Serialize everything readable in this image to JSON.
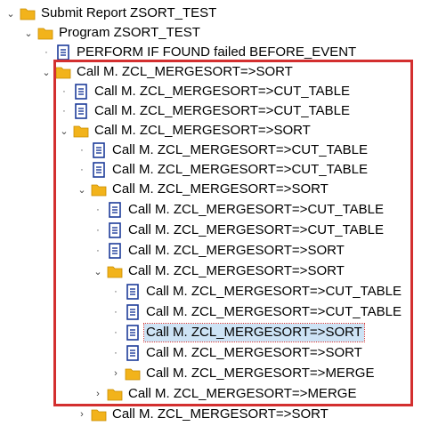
{
  "colors": {
    "folder": "#f2b31b",
    "doc": "#1d3c9a",
    "highlight_border": "#d32f2f",
    "selected_bg": "#cde3f5"
  },
  "tree": [
    {
      "label": "Submit Report ZSORT_TEST",
      "icon": "folder-icon",
      "toggle": "expanded"
    },
    {
      "label": "Program ZSORT_TEST",
      "icon": "folder-icon",
      "toggle": "expanded"
    },
    {
      "label": "PERFORM IF FOUND failed BEFORE_EVENT",
      "icon": "document-icon",
      "toggle": "leaf"
    },
    {
      "label": "Call M. ZCL_MERGESORT=>SORT",
      "icon": "folder-icon",
      "toggle": "expanded"
    },
    {
      "label": "Call M. ZCL_MERGESORT=>CUT_TABLE",
      "icon": "document-icon",
      "toggle": "leaf"
    },
    {
      "label": "Call M. ZCL_MERGESORT=>CUT_TABLE",
      "icon": "document-icon",
      "toggle": "leaf"
    },
    {
      "label": "Call M. ZCL_MERGESORT=>SORT",
      "icon": "folder-icon",
      "toggle": "expanded"
    },
    {
      "label": "Call M. ZCL_MERGESORT=>CUT_TABLE",
      "icon": "document-icon",
      "toggle": "leaf"
    },
    {
      "label": "Call M. ZCL_MERGESORT=>CUT_TABLE",
      "icon": "document-icon",
      "toggle": "leaf"
    },
    {
      "label": "Call M. ZCL_MERGESORT=>SORT",
      "icon": "folder-icon",
      "toggle": "expanded"
    },
    {
      "label": "Call M. ZCL_MERGESORT=>CUT_TABLE",
      "icon": "document-icon",
      "toggle": "leaf"
    },
    {
      "label": "Call M. ZCL_MERGESORT=>CUT_TABLE",
      "icon": "document-icon",
      "toggle": "leaf"
    },
    {
      "label": "Call M. ZCL_MERGESORT=>SORT",
      "icon": "document-icon",
      "toggle": "leaf"
    },
    {
      "label": "Call M. ZCL_MERGESORT=>SORT",
      "icon": "folder-icon",
      "toggle": "expanded"
    },
    {
      "label": "Call M. ZCL_MERGESORT=>CUT_TABLE",
      "icon": "document-icon",
      "toggle": "leaf"
    },
    {
      "label": "Call M. ZCL_MERGESORT=>CUT_TABLE",
      "icon": "document-icon",
      "toggle": "leaf"
    },
    {
      "label": "Call M. ZCL_MERGESORT=>SORT",
      "icon": "document-icon",
      "toggle": "leaf",
      "selected": true
    },
    {
      "label": "Call M. ZCL_MERGESORT=>SORT",
      "icon": "document-icon",
      "toggle": "leaf"
    },
    {
      "label": "Call M. ZCL_MERGESORT=>MERGE",
      "icon": "folder-icon",
      "toggle": "collapsed"
    },
    {
      "label": "Call M. ZCL_MERGESORT=>MERGE",
      "icon": "folder-icon",
      "toggle": "collapsed"
    },
    {
      "label": "Call M. ZCL_MERGESORT=>SORT",
      "icon": "folder-icon",
      "toggle": "collapsed"
    }
  ]
}
